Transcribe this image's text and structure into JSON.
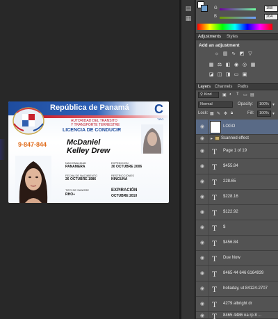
{
  "card": {
    "title": "República de Panamá",
    "authority_line1": "AUTORIDAD DEL TRANSITO",
    "authority_line2": "Y TRANSPORTE TERRESTRE",
    "license_type": "LICENCIA DE CONDUCIR",
    "class_letter": "C",
    "class_label": "TIPO",
    "id_number": "9-847-844",
    "first_name": "McDaniel",
    "last_name": "Kelley Drew",
    "fields": {
      "nationality_label": "NACIONALIDAD",
      "nationality_value": "PANAMERA",
      "issue_label": "EXPEDICION",
      "issue_value": "30 OCTUBRE 2006",
      "birth_label": "FECHA DE NACIMIENTO",
      "birth_value": "26 OCTUBRE 1986",
      "restrictions_label": "RESTRICCIONES",
      "restrictions_value": "NINGUNA",
      "blood_label": "TIPO DE SANGRE",
      "blood_value": "RHO+",
      "expiry_label": "EXPIRACIÓN",
      "expiry_value": "OCTUBRE 2010"
    }
  },
  "color_panel": {
    "g_label": "G",
    "g_value": "158",
    "b_label": "B",
    "b_value": "204"
  },
  "tabs_adjust": [
    "Adjustments",
    "Styles"
  ],
  "adjust_title": "Add an adjustment",
  "tabs_layers": [
    "Layers",
    "Channels",
    "Paths"
  ],
  "layers_ctl": {
    "kind": "Kind",
    "blend": "Normal",
    "opacity_label": "Opacity:",
    "opacity_value": "100%",
    "lock_label": "Lock:",
    "fill_label": "Fill:",
    "fill_value": "100%"
  },
  "layers": [
    {
      "name": "LOGO",
      "kind": "image",
      "selected": true
    },
    {
      "name": "Scanned effect",
      "kind": "group"
    },
    {
      "name": "Page 1 of 19",
      "kind": "text"
    },
    {
      "name": "$455.84",
      "kind": "text"
    },
    {
      "name": "228.65",
      "kind": "text"
    },
    {
      "name": "$228.16",
      "kind": "text"
    },
    {
      "name": "$122.92",
      "kind": "text"
    },
    {
      "name": "$",
      "kind": "text"
    },
    {
      "name": "$456.84",
      "kind": "text"
    },
    {
      "name": "Due Now",
      "kind": "text"
    },
    {
      "name": "8465 44 646 6164939",
      "kind": "text"
    },
    {
      "name": "holladay, ut 84124-2707",
      "kind": "text"
    },
    {
      "name": "4279 albright dr",
      "kind": "text"
    },
    {
      "name": "8465 4486 na rp 8 ...",
      "kind": "text"
    }
  ],
  "colors": {
    "accent_blue": "#1d4b9c",
    "accent_red": "#c21d2b",
    "number_orange": "#e06a18",
    "panel_bg": "#535353",
    "selected_row": "#596a86"
  }
}
